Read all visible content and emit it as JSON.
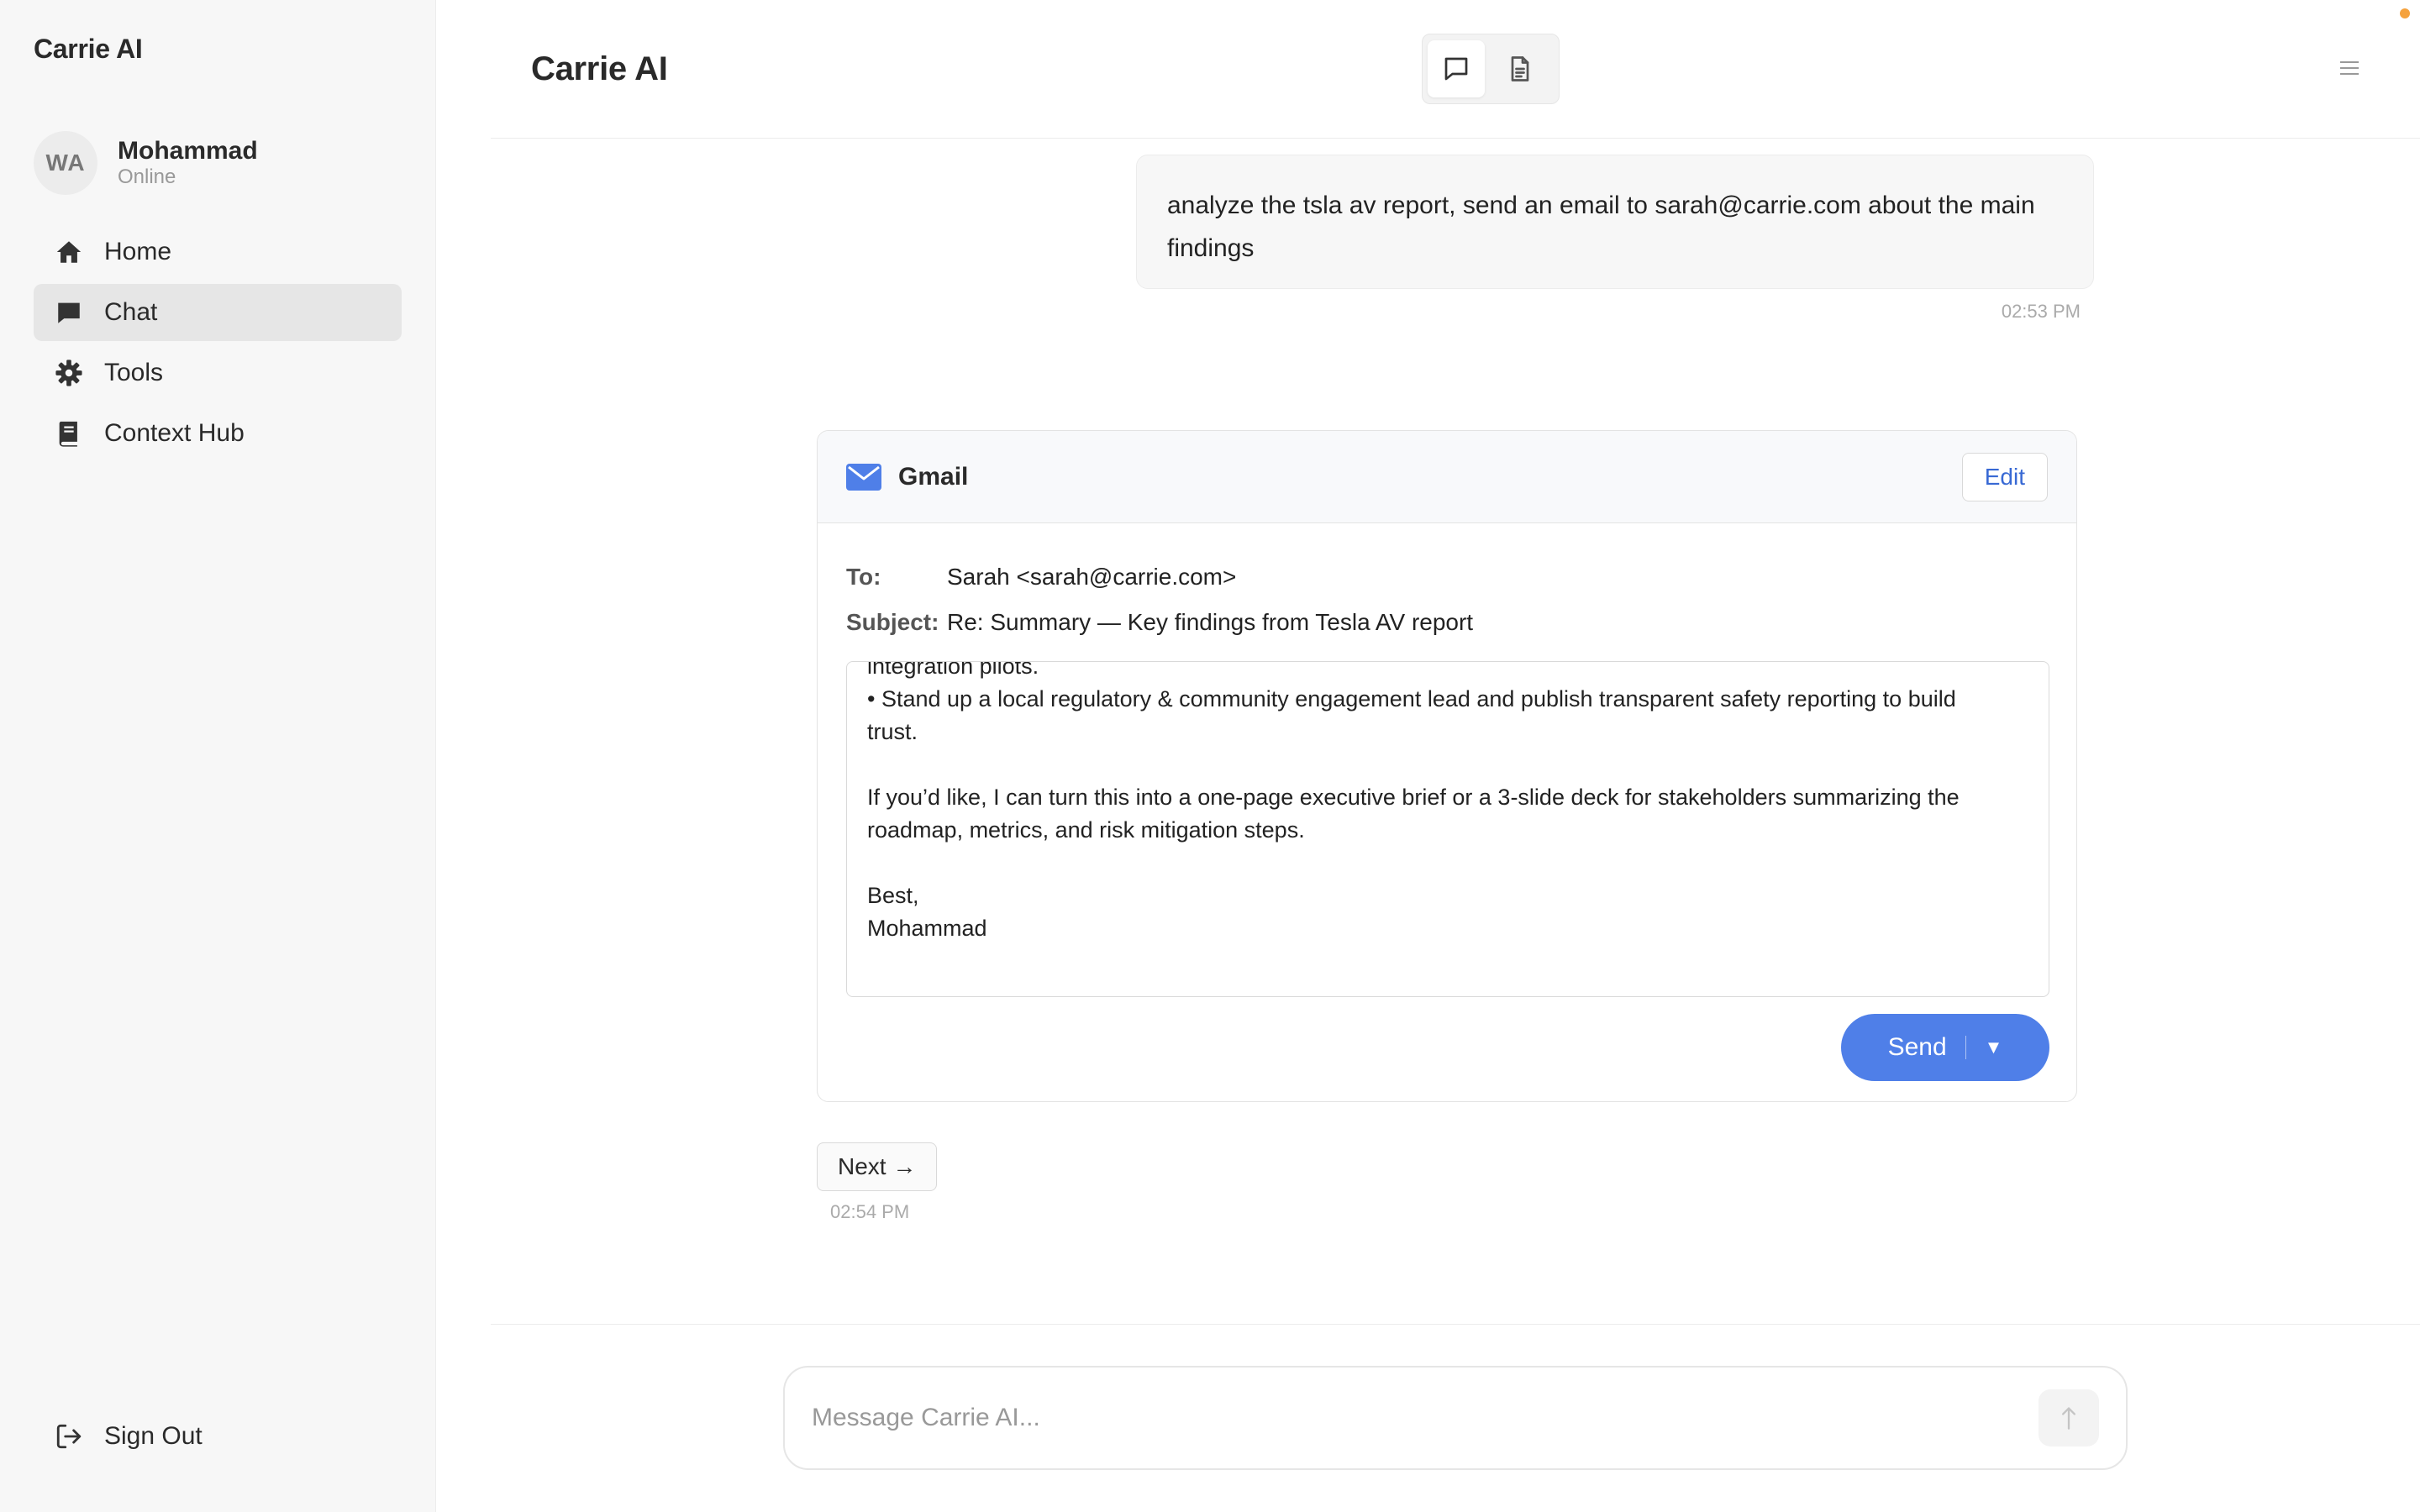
{
  "app": {
    "brand": "Carrie AI"
  },
  "user": {
    "initials": "WA",
    "name": "Mohammad",
    "status": "Online"
  },
  "nav": {
    "items": [
      {
        "label": "Home",
        "icon": "home-icon",
        "active": false
      },
      {
        "label": "Chat",
        "icon": "chat-icon",
        "active": true
      },
      {
        "label": "Tools",
        "icon": "gear-icon",
        "active": false
      },
      {
        "label": "Context Hub",
        "icon": "book-icon",
        "active": false
      }
    ],
    "sign_out": "Sign Out"
  },
  "header": {
    "title": "Carrie AI",
    "active_view": "chat"
  },
  "chat": {
    "user_message": {
      "text": "analyze the tsla av report, send an email to sarah@carrie.com about the main findings",
      "time": "02:53 PM"
    },
    "gmail": {
      "title": "Gmail",
      "edit_label": "Edit",
      "to_label": "To:",
      "to_value": "Sarah <sarah@carrie.com>",
      "subject_label": "Subject:",
      "subject_value": "Re: Summary — Key findings from Tesla AV report",
      "body": "integration pilots.\n• Stand up a local regulatory & community engagement lead and publish transparent safety reporting to build trust.\n\nIf you’d like, I can turn this into a one-page executive brief or a 3-slide deck for stakeholders summarizing the roadmap, metrics, and risk mitigation steps.\n\nBest,\nMohammad",
      "send_label": "Send",
      "send_caret": "▼"
    },
    "next": {
      "label": "Next →",
      "time": "02:54 PM"
    }
  },
  "composer": {
    "placeholder": "Message Carrie AI..."
  },
  "colors": {
    "accent": "#4f7fe8",
    "link": "#3869d4",
    "status_dot": "#f5a23d"
  }
}
